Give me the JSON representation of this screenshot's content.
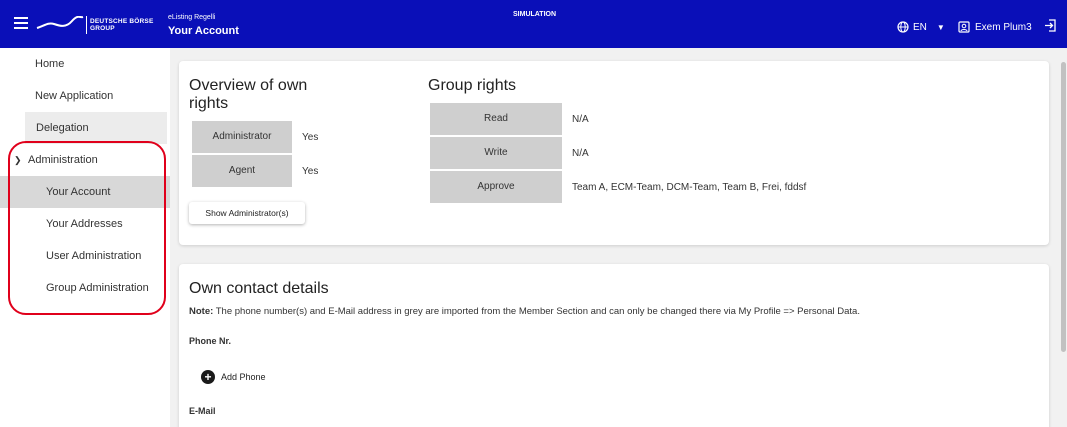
{
  "header": {
    "logo_text_line1": "DEUTSCHE BÖRSE",
    "logo_text_line2": "GROUP",
    "app_subtitle": "eListing Regelli",
    "page_title": "Your Account",
    "environment": "SIMULATION",
    "language": "EN",
    "user_name": "Exem Plum3"
  },
  "sidebar": {
    "items": [
      {
        "label": "Home"
      },
      {
        "label": "New Application"
      },
      {
        "label": "Delegation"
      },
      {
        "label": "Administration"
      },
      {
        "label": "Your Account"
      },
      {
        "label": "Your Addresses"
      },
      {
        "label": "User Administration"
      },
      {
        "label": "Group Administration"
      }
    ]
  },
  "overview": {
    "title": "Overview of own rights",
    "rights": [
      {
        "name": "Administrator",
        "value": "Yes"
      },
      {
        "name": "Agent",
        "value": "Yes"
      }
    ],
    "show_admins_button": "Show Administrator(s)"
  },
  "group_rights": {
    "title": "Group rights",
    "rows": [
      {
        "name": "Read",
        "value": "N/A"
      },
      {
        "name": "Write",
        "value": "N/A"
      },
      {
        "name": "Approve",
        "value": "Team A, ECM-Team, DCM-Team, Team B, Frei, fddsf"
      }
    ]
  },
  "contact": {
    "title": "Own contact details",
    "note_label": "Note:",
    "note_text": " The phone number(s) and E-Mail address in grey are imported from the Member Section and can only be changed there via My Profile => Personal Data.",
    "phone_label": "Phone Nr.",
    "add_phone": "Add Phone",
    "email_label": "E-Mail"
  },
  "colors": {
    "header_bg": "#0a0fb8",
    "annotation": "#e0001b",
    "selected_nav": "#d8d8d8"
  }
}
